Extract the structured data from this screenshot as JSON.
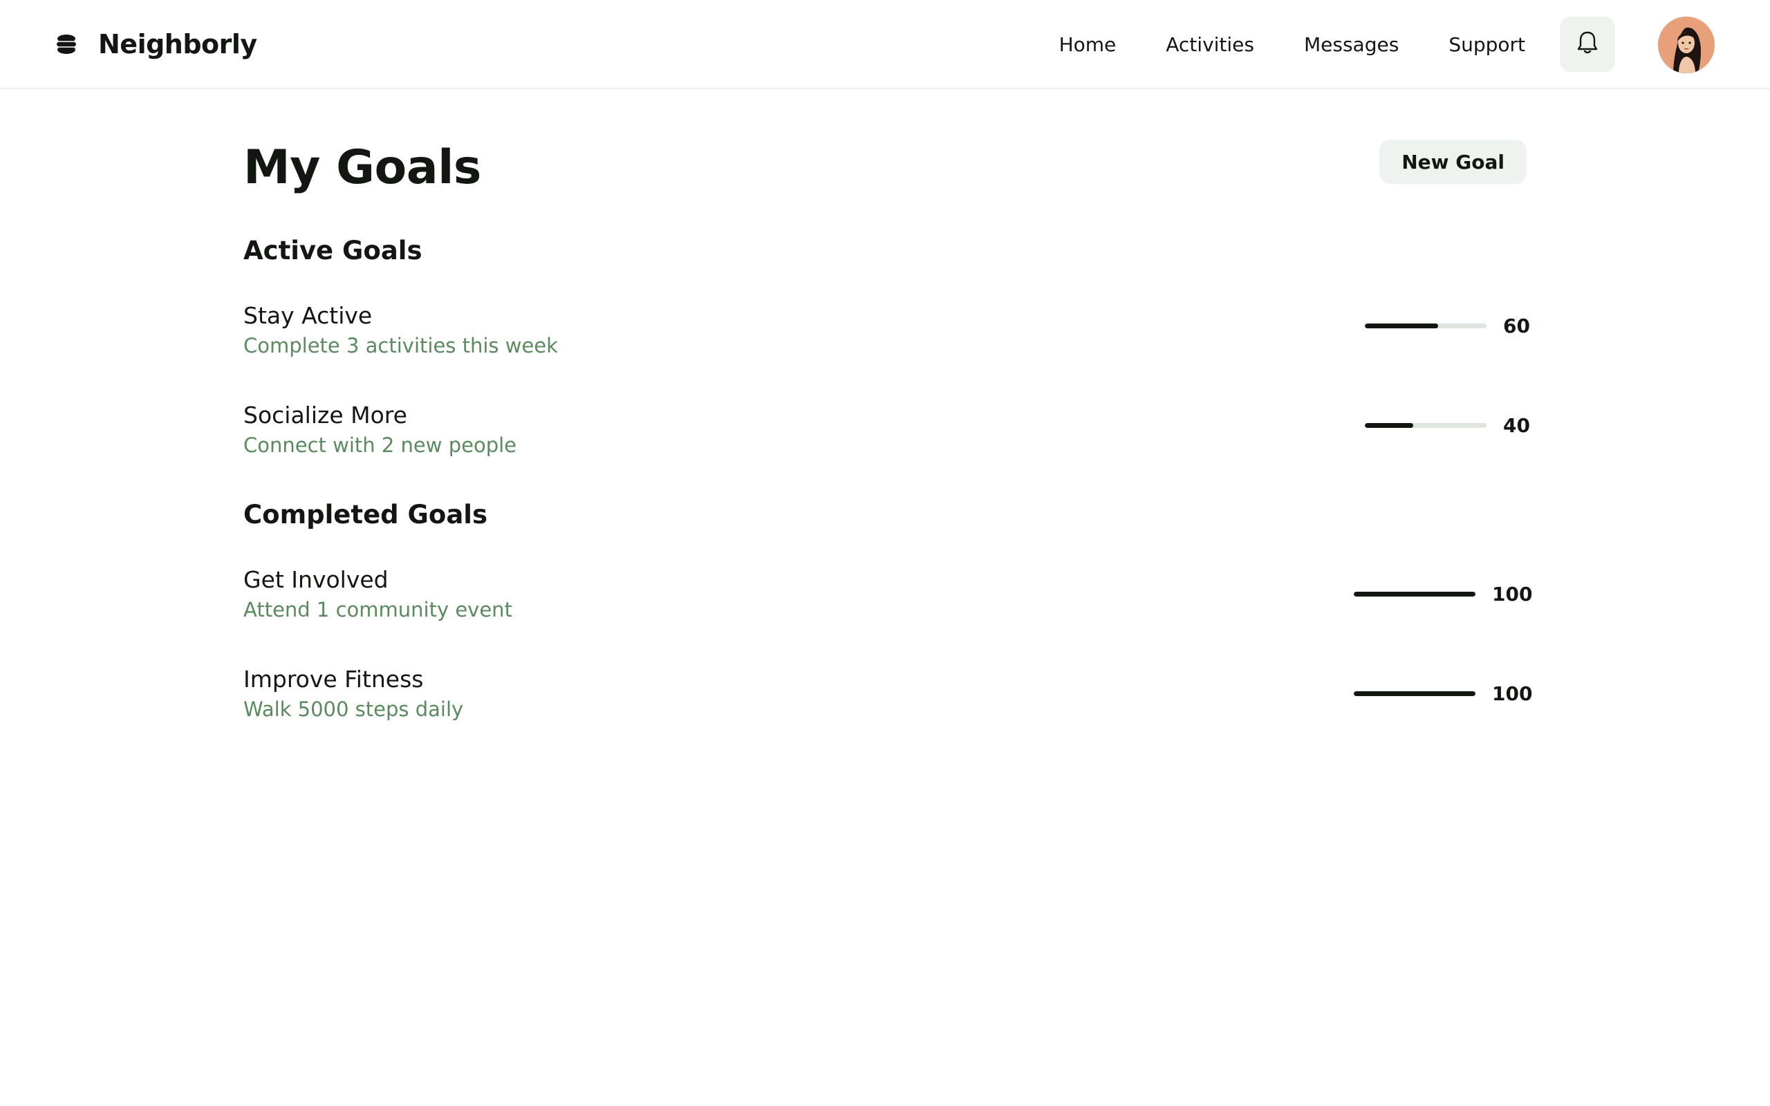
{
  "header": {
    "brand": "Neighborly",
    "nav": [
      "Home",
      "Activities",
      "Messages",
      "Support"
    ],
    "icons": {
      "logo": "stacked-disc-logo-icon",
      "notifications": "bell-icon",
      "avatar": "user-avatar"
    }
  },
  "page": {
    "title": "My Goals",
    "new_goal_label": "New Goal"
  },
  "sections": {
    "active": {
      "title": "Active Goals",
      "goals": [
        {
          "title": "Stay Active",
          "description": "Complete 3 activities this week",
          "progress": 60
        },
        {
          "title": "Socialize More",
          "description": "Connect with 2 new people",
          "progress": 40
        }
      ]
    },
    "completed": {
      "title": "Completed Goals",
      "goals": [
        {
          "title": "Get Involved",
          "description": "Attend 1 community event",
          "progress": 100
        },
        {
          "title": "Improve Fitness",
          "description": "Walk 5000 steps daily",
          "progress": 100
        }
      ]
    }
  },
  "colors": {
    "text": "#121712",
    "accent_green_text": "#5b8a5f",
    "button_bg": "#eef3ef",
    "track": "#dfe6e0",
    "fill": "#121712"
  }
}
